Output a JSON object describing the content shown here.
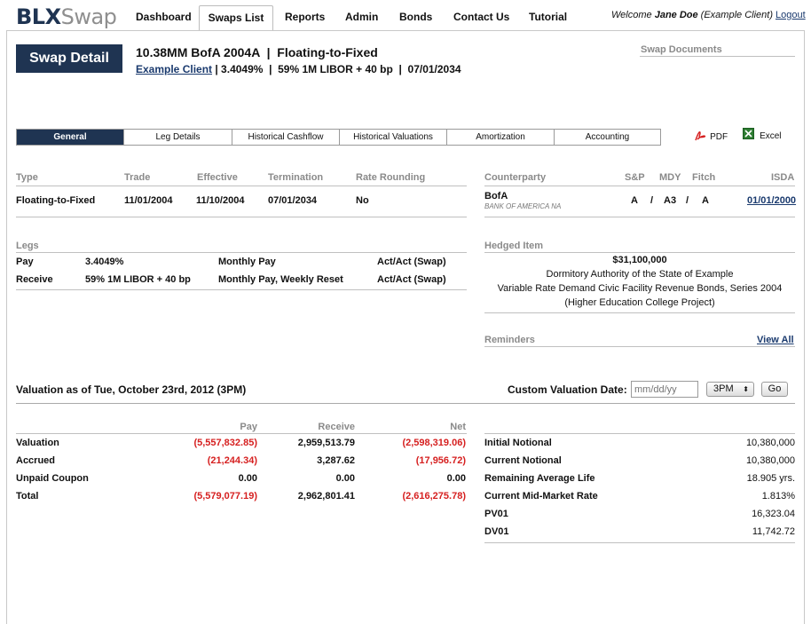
{
  "app": {
    "logo_a": "BLX",
    "logo_b": "Swap"
  },
  "nav": {
    "items": [
      "Dashboard",
      "Swaps List",
      "Reports",
      "Admin",
      "Bonds",
      "Contact Us",
      "Tutorial"
    ],
    "welcome_prefix": "Welcome ",
    "user_name": "Jane Doe",
    "user_client": " (Example Client)",
    "logout": "Logout"
  },
  "header": {
    "swap_detail": "Swap Detail",
    "title": "10.38MM BofA 2004A  |  Floating-to-Fixed",
    "client_link": "Example Client",
    "subtitle": " | 3.4049%  |  59% 1M LIBOR + 40 bp  |  07/01/2034",
    "swap_documents": "Swap Documents"
  },
  "tabs": [
    "General",
    "Leg Details",
    "Historical Cashflow",
    "Historical Valuations",
    "Amortization",
    "Accounting"
  ],
  "exports": {
    "pdf": "PDF",
    "excel": "Excel"
  },
  "general": {
    "headers": [
      "Type",
      "Trade",
      "Effective",
      "Termination",
      "Rate Rounding"
    ],
    "values": [
      "Floating-to-Fixed",
      "11/01/2004",
      "11/10/2004",
      "07/01/2034",
      "No"
    ]
  },
  "counterparty": {
    "headers": [
      "Counterparty",
      "S&P",
      "MDY",
      "Fitch",
      "ISDA"
    ],
    "name": "BofA",
    "full": "BANK OF AMERICA NA",
    "sp": "A",
    "mdy": "A3",
    "fitch": "A",
    "sep": "/",
    "isda": "01/01/2000"
  },
  "legs": {
    "title": "Legs",
    "rows": [
      [
        "Pay",
        "3.4049%",
        "Monthly Pay",
        "Act/Act (Swap)"
      ],
      [
        "Receive",
        "59% 1M LIBOR + 40 bp",
        "Monthly Pay, Weekly Reset",
        "Act/Act (Swap)"
      ]
    ]
  },
  "hedged": {
    "title": "Hedged Item",
    "amount": "$31,100,000",
    "lines": [
      "Dormitory Authority of the State of Example",
      "Variable Rate Demand Civic Facility Revenue Bonds, Series 2004",
      "(Higher Education College Project)"
    ]
  },
  "reminders": {
    "title": "Reminders",
    "view_all": "View All"
  },
  "valuation": {
    "title": "Valuation as of Tue, October 23rd, 2012 (3PM)",
    "custom_label": "Custom Valuation Date:",
    "date_placeholder": "mm/dd/yy",
    "time": "3PM",
    "go": "Go",
    "cols": [
      "Pay",
      "Receive",
      "Net"
    ],
    "rows": [
      {
        "label": "Valuation",
        "pay": "(5,557,832.85)",
        "receive": "2,959,513.79",
        "net": "(2,598,319.06)",
        "pay_neg": true,
        "net_neg": true
      },
      {
        "label": "Accrued",
        "pay": "(21,244.34)",
        "receive": "3,287.62",
        "net": "(17,956.72)",
        "pay_neg": true,
        "net_neg": true
      },
      {
        "label": "Unpaid Coupon",
        "pay": "0.00",
        "receive": "0.00",
        "net": "0.00",
        "pay_neg": false,
        "net_neg": false
      },
      {
        "label": "Total",
        "pay": "(5,579,077.19)",
        "receive": "2,962,801.41",
        "net": "(2,616,275.78)",
        "pay_neg": true,
        "net_neg": true
      }
    ]
  },
  "stats": [
    [
      "Initial Notional",
      "10,380,000"
    ],
    [
      "Current Notional",
      "10,380,000"
    ],
    [
      "Remaining Average Life",
      "18.905 yrs."
    ],
    [
      "Current Mid-Market Rate",
      "1.813%"
    ],
    [
      "PV01",
      "16,323.04"
    ],
    [
      "DV01",
      "11,742.72"
    ]
  ],
  "colors": {
    "navy": "#1f3452",
    "negative": "#d62020",
    "link": "#1a3a6e"
  }
}
